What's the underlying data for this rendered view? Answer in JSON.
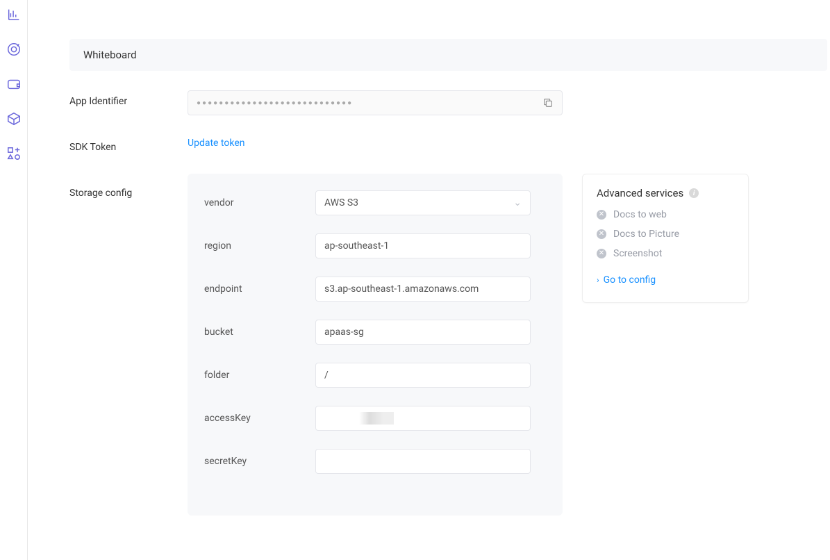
{
  "sidebar": {
    "icons": [
      "bar-chart-icon",
      "target-icon",
      "wallet-icon",
      "box-icon",
      "shapes-icon"
    ]
  },
  "section": {
    "title": "Whiteboard"
  },
  "app_identifier": {
    "label": "App Identifier"
  },
  "sdk_token": {
    "label": "SDK Token",
    "action": "Update token"
  },
  "storage": {
    "label": "Storage config",
    "fields": {
      "vendor": {
        "label": "vendor",
        "value": "AWS S3"
      },
      "region": {
        "label": "region",
        "value": "ap-southeast-1"
      },
      "endpoint": {
        "label": "endpoint",
        "value": "s3.ap-southeast-1.amazonaws.com"
      },
      "bucket": {
        "label": "bucket",
        "value": "apaas-sg"
      },
      "folder": {
        "label": "folder",
        "value": "/"
      },
      "accessKey": {
        "label": "accessKey",
        "value": ""
      },
      "secretKey": {
        "label": "secretKey",
        "value": ""
      }
    }
  },
  "advanced": {
    "title": "Advanced services",
    "items": [
      {
        "label": "Docs to web"
      },
      {
        "label": "Docs to Picture"
      },
      {
        "label": "Screenshot"
      }
    ],
    "link": "Go to config"
  }
}
